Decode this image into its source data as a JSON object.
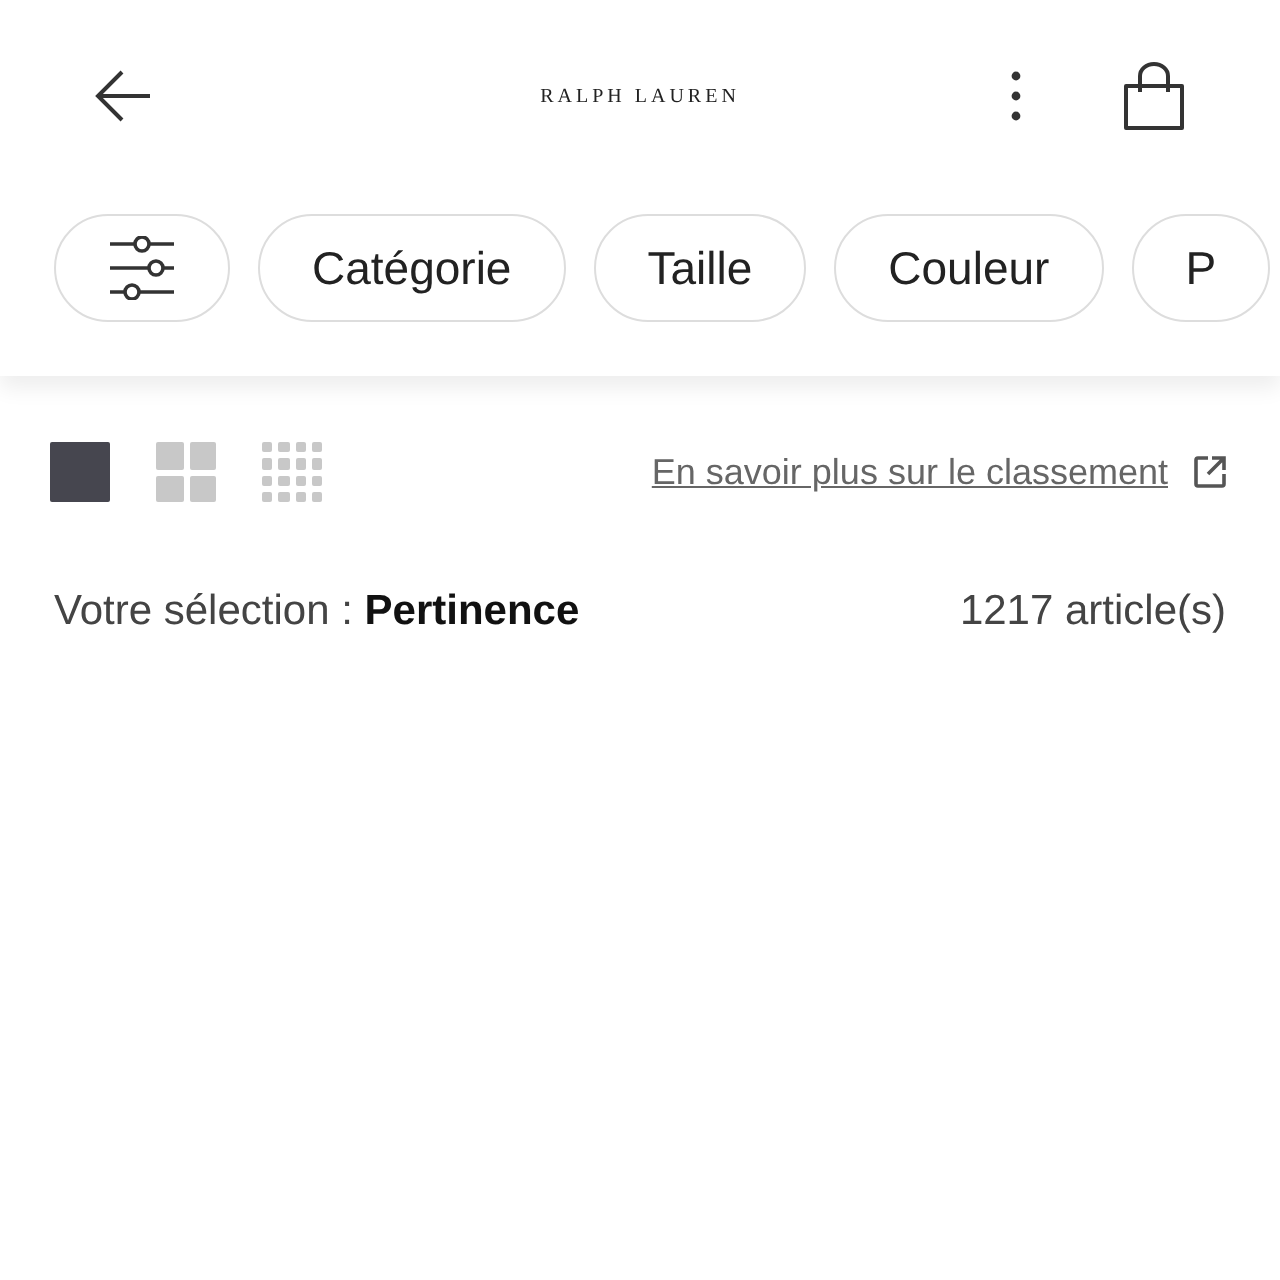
{
  "header": {
    "logo": "RALPH LAUREN"
  },
  "filters": [
    {
      "kind": "settings"
    },
    {
      "kind": "chip",
      "label": "Catégorie"
    },
    {
      "kind": "chip",
      "label": "Taille"
    },
    {
      "kind": "chip",
      "label": "Couleur"
    },
    {
      "kind": "chip",
      "label": "P"
    }
  ],
  "views": [
    {
      "kind": "single",
      "selected": true
    },
    {
      "kind": "grid4",
      "selected": false
    },
    {
      "kind": "grid16",
      "selected": false
    }
  ],
  "ranking_link": "En savoir plus sur le classement",
  "sort": {
    "label": "Votre sélection :",
    "value": "Pertinence"
  },
  "count": "1217 article(s)"
}
